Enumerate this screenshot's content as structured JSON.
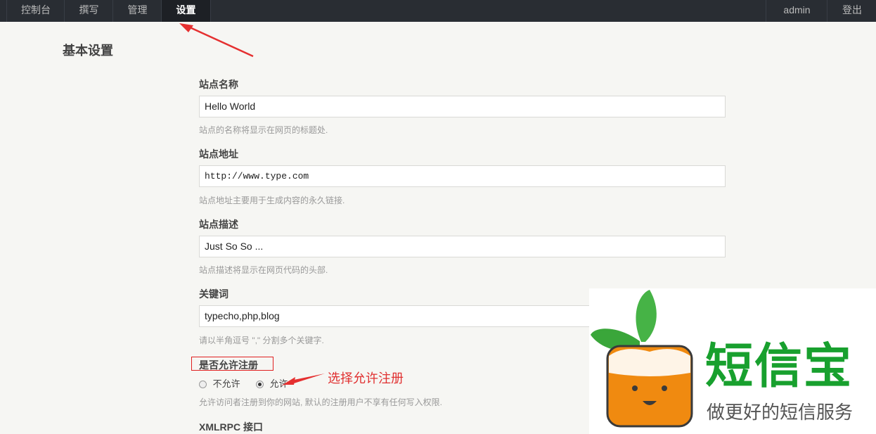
{
  "nav": {
    "items": [
      {
        "label": "控制台"
      },
      {
        "label": "撰写"
      },
      {
        "label": "管理"
      },
      {
        "label": "设置"
      }
    ],
    "user": "admin",
    "logout": "登出"
  },
  "page": {
    "title": "基本设置"
  },
  "form": {
    "site_name": {
      "label": "站点名称",
      "value": "Hello World",
      "desc": "站点的名称将显示在网页的标题处."
    },
    "site_url": {
      "label": "站点地址",
      "value": "http://www.type.com",
      "desc": "站点地址主要用于生成内容的永久链接."
    },
    "site_desc": {
      "label": "站点描述",
      "value": "Just So So ...",
      "desc": "站点描述将显示在网页代码的头部."
    },
    "keywords": {
      "label": "关键词",
      "value": "typecho,php,blog",
      "desc": "请以半角逗号 \",\" 分割多个关键字."
    },
    "allow_register": {
      "label": "是否允许注册",
      "options": [
        {
          "label": "不允许",
          "checked": false
        },
        {
          "label": "允许",
          "checked": true
        }
      ],
      "desc": "允许访问者注册到你的网站, 默认的注册用户不享有任何写入权限."
    },
    "xmlrpc": {
      "label": "XMLRPC 接口"
    }
  },
  "annotation": {
    "text": "选择允许注册",
    "color": "#e03030"
  },
  "brand": {
    "title": "短信宝",
    "subtitle": "做更好的短信服务",
    "title_color": "#18a02e",
    "mascot_color": "#f08a10",
    "leaf_color": "#3aa63a"
  }
}
